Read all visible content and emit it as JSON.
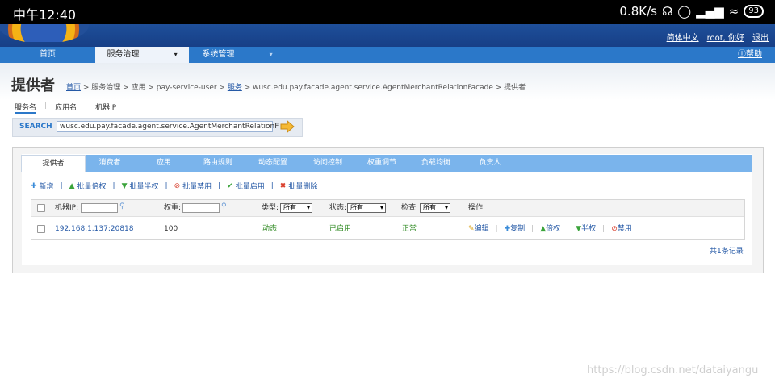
{
  "status_bar": {
    "time": "中午12:40",
    "speed": "0.8K/s",
    "battery": "93"
  },
  "top_links": {
    "language": "简体中文",
    "user": "root, 你好",
    "logout": "退出"
  },
  "nav": {
    "items": [
      {
        "label": "首页"
      },
      {
        "label": "服务治理"
      },
      {
        "label": "系统管理"
      }
    ],
    "help": "帮助"
  },
  "page": {
    "title": "提供者"
  },
  "breadcrumb": {
    "home": "首页",
    "trail1": " > 服务治理 > 应用 > pay-service-user > ",
    "service_link": "服务",
    "trail2": " > wusc.edu.pay.facade.agent.service.AgentMerchantRelationFacade > 提供者"
  },
  "search": {
    "tabs": [
      "服务名",
      "应用名",
      "机器IP"
    ],
    "label": "SEARCH",
    "value": "wusc.edu.pay.facade.agent.service.AgentMerchantRelationF"
  },
  "tabs": [
    "提供者",
    "消费者",
    "应用",
    "路由规则",
    "动态配置",
    "访问控制",
    "权重调节",
    "负载均衡",
    "负责人"
  ],
  "toolbar": [
    "新增",
    "批量倍权",
    "批量半权",
    "批量禁用",
    "批量启用",
    "批量删除"
  ],
  "table": {
    "headers": {
      "ip": "机器IP:",
      "weight": "权重:",
      "type": "类型:",
      "status": "状态:",
      "check": "检查:",
      "ops": "操作"
    },
    "filters": {
      "type": "所有",
      "status": "所有",
      "check": "所有"
    },
    "rows": [
      {
        "ip": "192.168.1.137:20818",
        "weight": "100",
        "type": "动态",
        "status": "已启用",
        "check": "正常"
      }
    ],
    "row_actions": [
      "编辑",
      "复制",
      "倍权",
      "半权",
      "禁用"
    ],
    "total": "共1条记录"
  },
  "watermark": "https://blog.csdn.net/dataiyangu",
  "colors": {
    "nav": "#2b78c9",
    "tabbar": "#7ab4ec",
    "link": "#2559a6",
    "green": "#2f8a22"
  }
}
